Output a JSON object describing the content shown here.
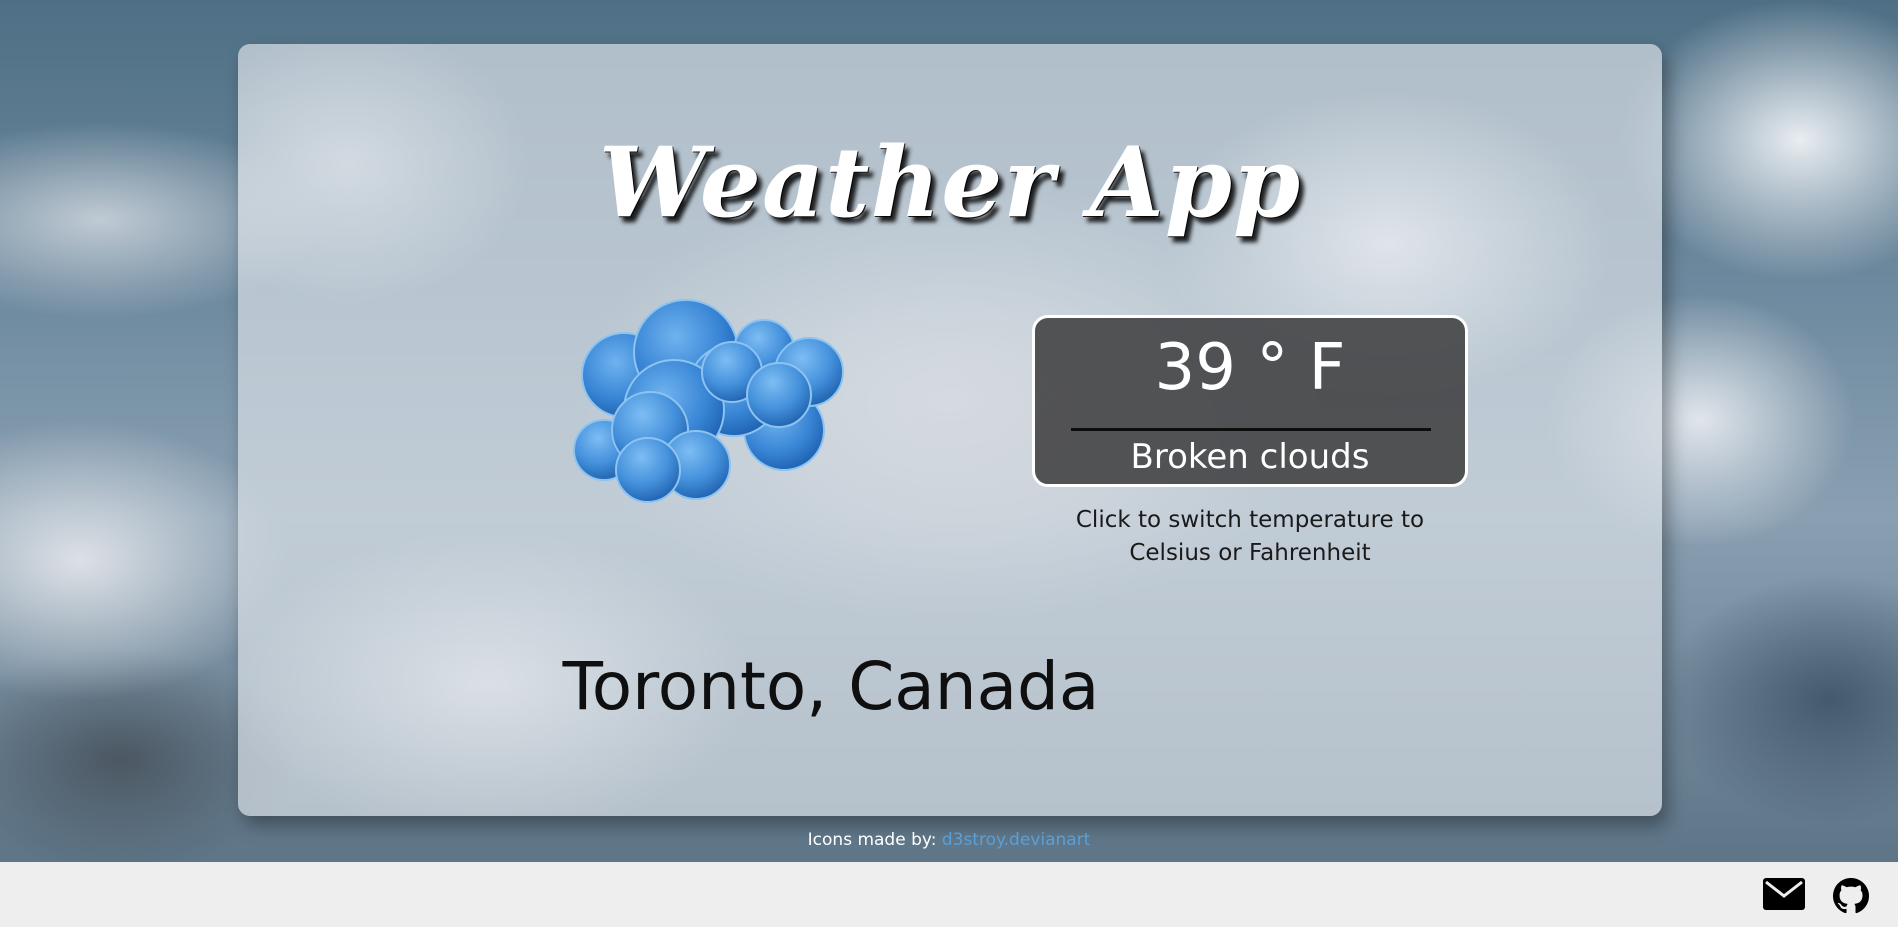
{
  "app": {
    "title": "Weather App"
  },
  "weather": {
    "icon": "broken-clouds-icon",
    "temperature": "39 ° F",
    "description": "Broken clouds",
    "unit_hint": "Click to switch temperature to Celsius or Fahrenheit",
    "location": "Toronto, Canada"
  },
  "credits": {
    "prefix": "Icons made by:",
    "link_text": "d3stroy.devianart"
  },
  "footer": {
    "icons": [
      "mail-icon",
      "github-icon"
    ]
  },
  "colors": {
    "card_background": "#d6dce3",
    "temp_box_background": "#3c3c3e",
    "cloud_blue": "#3a86d6",
    "link": "#5b9fd6",
    "footer_background": "#eeeeee"
  }
}
